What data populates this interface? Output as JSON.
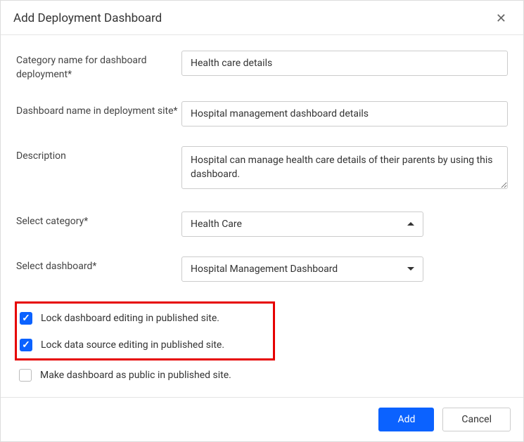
{
  "header": {
    "title": "Add Deployment Dashboard"
  },
  "form": {
    "categoryName": {
      "label": "Category name for dashboard deployment*",
      "value": "Health care details"
    },
    "dashboardName": {
      "label": "Dashboard name in deployment site*",
      "value": "Hospital management dashboard details"
    },
    "description": {
      "label": "Description",
      "value": "Hospital can manage health care details of their parents by using this dashboard."
    },
    "selectCategory": {
      "label": "Select category*",
      "value": "Health Care"
    },
    "selectDashboard": {
      "label": "Select dashboard*",
      "value": "Hospital Management Dashboard"
    }
  },
  "checkboxes": {
    "lockDashboard": {
      "label": "Lock dashboard editing in published site.",
      "checked": true
    },
    "lockDataSource": {
      "label": "Lock data source editing in published site.",
      "checked": true
    },
    "makePublic": {
      "label": "Make dashboard as public in published site.",
      "checked": false
    }
  },
  "footer": {
    "addLabel": "Add",
    "cancelLabel": "Cancel"
  }
}
